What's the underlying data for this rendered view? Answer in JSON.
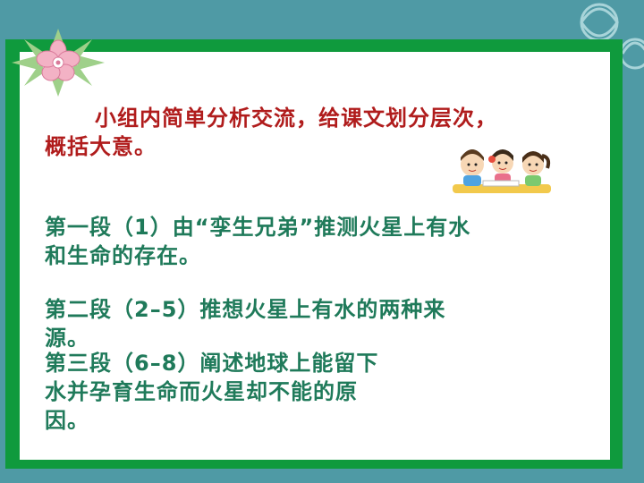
{
  "slide": {
    "intro_line1": "小组内简单分析交流，给课文划分层次，",
    "intro_line2": "概括大意。",
    "para1_line1": "第一段（1）由“孪生兄弟”推测火星上有水",
    "para1_line2": "和生命的存在。",
    "para2_line1": "第二段（2–5）推想火星上有水的两种来",
    "para2_line2": "源。",
    "para3_line1": "第三段（6–8）阐述地球上能留下",
    "para3_line2": "水并孕育生命而火星却不能的原",
    "para3_line3": "因。"
  },
  "colors": {
    "background": "#4f9aa5",
    "frame_green": "#0f9a3d",
    "intro_text": "#b01c1c",
    "body_text": "#1f7a5a"
  },
  "icons": [
    "flower-icon",
    "children-reading-icon",
    "snowflake-pattern-icon"
  ]
}
